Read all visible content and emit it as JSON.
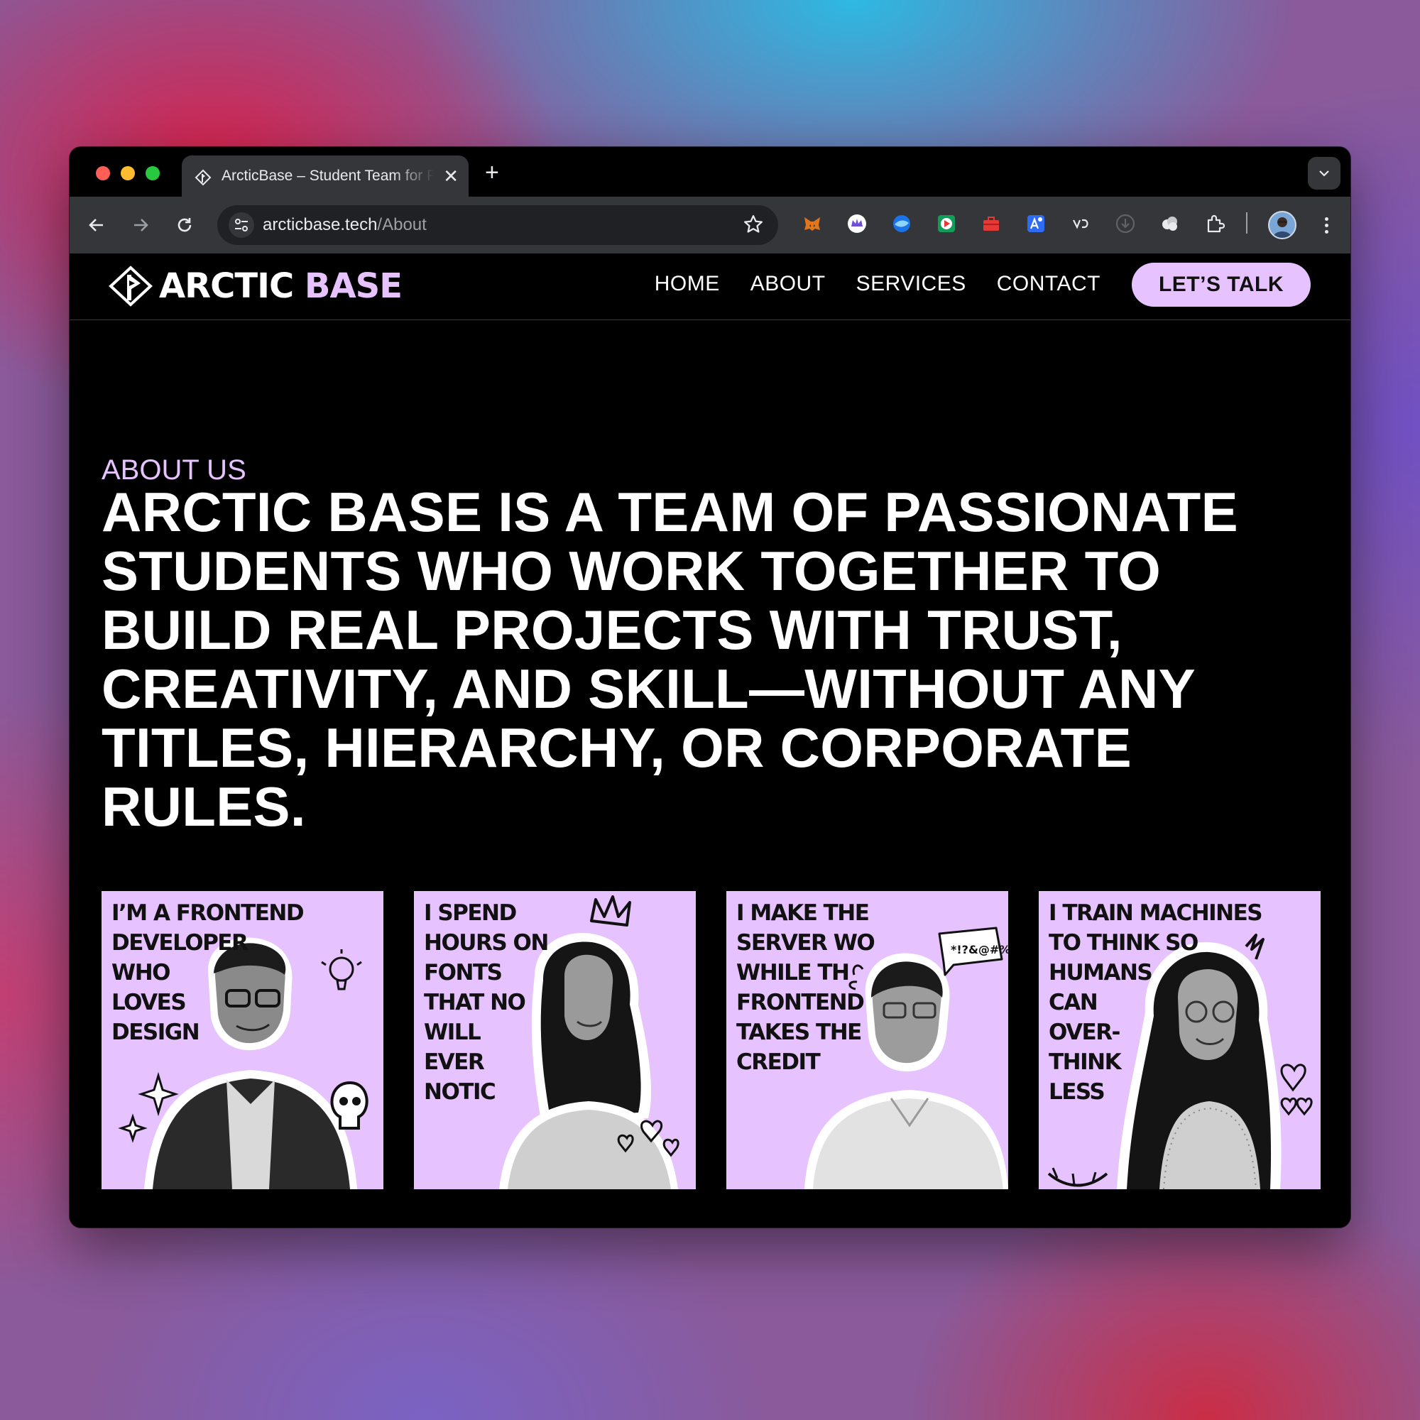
{
  "browser": {
    "tab_title": "ArcticBase – Student Team for Real Projects",
    "url_host": "arcticbase.tech",
    "url_path": "/About",
    "extensions": [
      "metamask-icon",
      "crown-extension-icon",
      "globe-extension-icon",
      "play-extension-icon",
      "toolbox-extension-icon",
      "translate-extension-icon",
      "vd-extension-icon",
      "download-extension-icon",
      "cloud-extension-icon",
      "puzzle-icon"
    ]
  },
  "site": {
    "logo_main": "ARCTIC",
    "logo_accent": "BASE",
    "nav": [
      {
        "label": "HOME"
      },
      {
        "label": "ABOUT"
      },
      {
        "label": "SERVICES"
      },
      {
        "label": "CONTACT"
      }
    ],
    "cta": "LET’S TALK"
  },
  "hero": {
    "eyebrow": "ABOUT US",
    "headline": "ARCTIC BASE IS A TEAM OF PASSIONATE STUDENTS WHO WORK TOGETHER TO BUILD REAL PROJECTS WITH TRUST, CREATIVITY, AND SKILL—WITHOUT ANY TITLES, HIERARCHY, OR CORPORATE RULES."
  },
  "team": [
    {
      "text": "I’M A FRONTEND\nDEVELOPER\nWHO\nLOVES\nDESIGN"
    },
    {
      "text": "I SPEND\nHOURS ON\nFONTS\nTHAT NO\nWILL\nEVER\nNOTIC"
    },
    {
      "text": "I MAKE THE\nSERVER WO\nWHILE TH\nFRONTEND\nTAKES THE\nCREDIT"
    },
    {
      "text": "I TRAIN MACHINES\nTO THINK SO\nHUMANS\nCAN\nOVER-\nTHINK\nLESS"
    }
  ],
  "colors": {
    "accent": "#e6c2ff",
    "page_bg": "#000000",
    "chrome_toolbar": "#35363a"
  }
}
